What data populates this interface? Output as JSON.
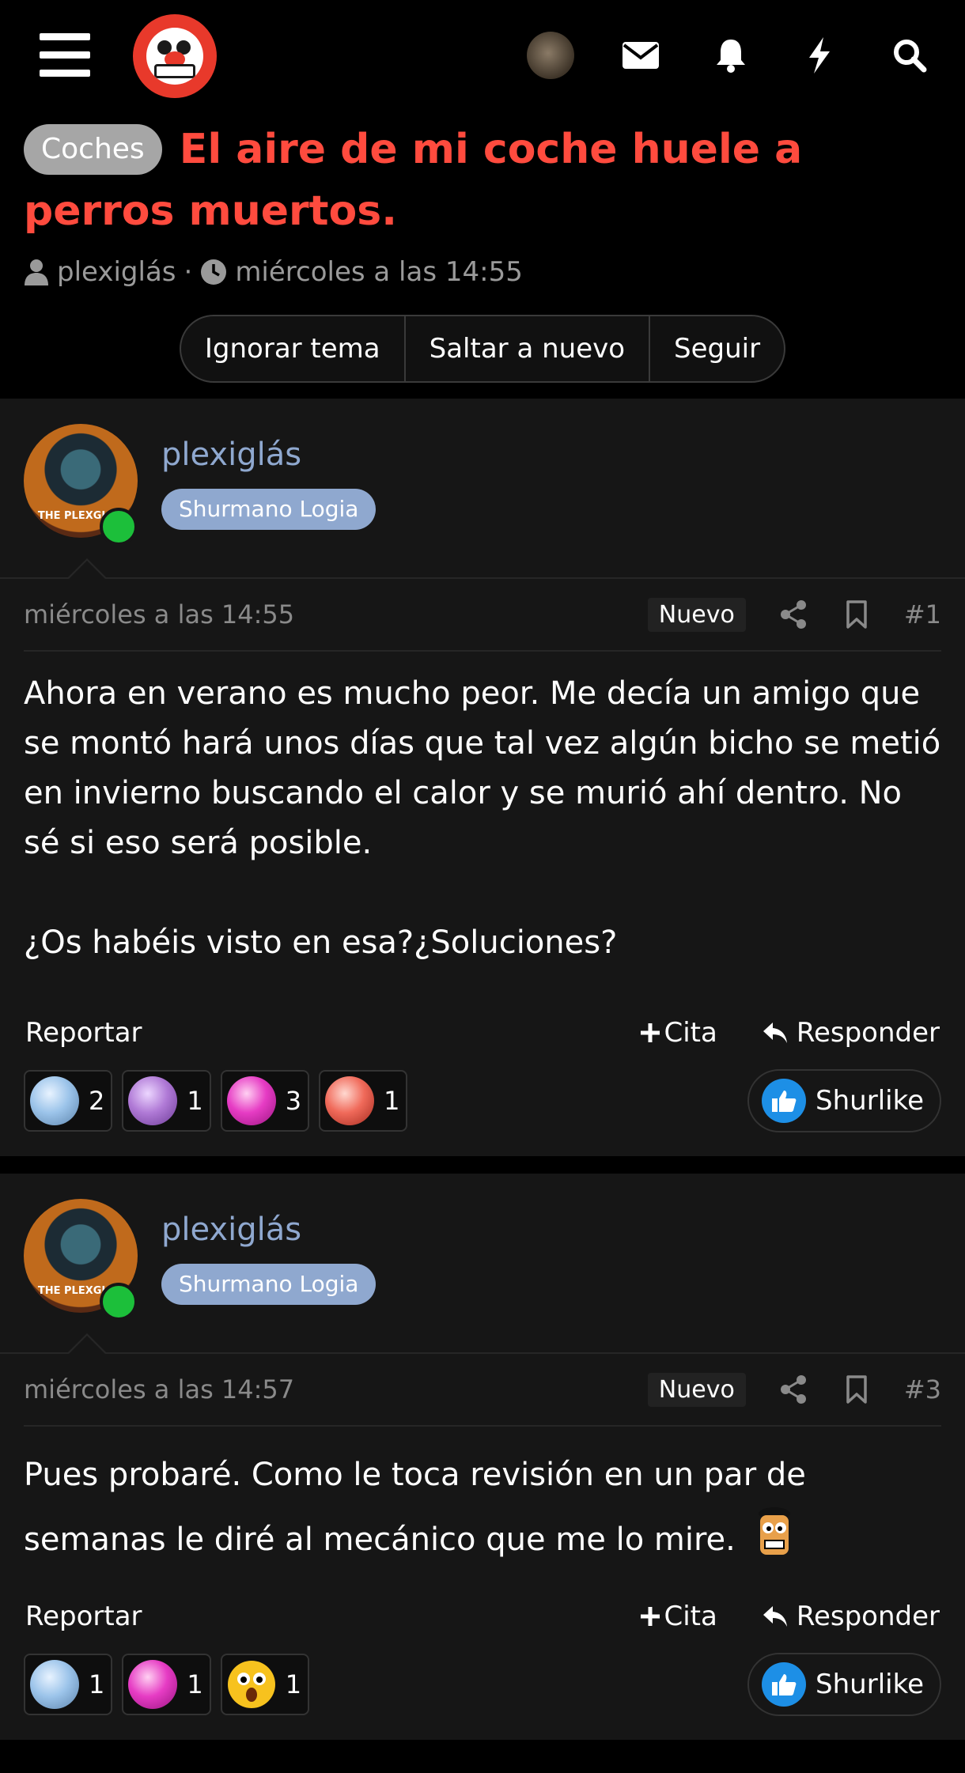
{
  "header": {
    "menu_icon": "hamburger-icon",
    "logo": "shurbird-logo",
    "icons": [
      "mail-icon",
      "bell-icon",
      "bolt-icon",
      "search-icon"
    ]
  },
  "thread": {
    "prefix": "Coches",
    "title": "El aire de mi coche huele a perros muertos.",
    "author": "plexiglás",
    "separator": "·",
    "date": "miércoles a las 14:55",
    "actions": [
      "Ignorar tema",
      "Saltar a nuevo",
      "Seguir"
    ]
  },
  "posts": [
    {
      "username": "plexiglás",
      "badge": "Shurmano Logia",
      "avatar_caption": "THE PLEXGLAS",
      "date": "miércoles a las 14:55",
      "new_label": "Nuevo",
      "number": "#1",
      "paragraphs": [
        "Ahora en verano es mucho peor. Me decía un amigo que se montó hará unos días que tal vez algún bicho se metió en invierno buscando el calor y se murió ahí dentro. No sé si eso será posible.",
        "¿Os habéis visto en esa?¿Soluciones?"
      ],
      "report": "Reportar",
      "quote": "Cita",
      "reply": "Responder",
      "reactions": [
        {
          "icon": "blue-gem-icon",
          "color": "#9cc4ea",
          "count": "2"
        },
        {
          "icon": "purple-gem-icon",
          "color": "#b07ad6",
          "count": "1"
        },
        {
          "icon": "pink-gem-icon",
          "color": "#e63cc4",
          "count": "3"
        },
        {
          "icon": "red-gem-icon",
          "color": "#f06a5a",
          "count": "1"
        }
      ],
      "like_label": "Shurlike"
    },
    {
      "username": "plexiglás",
      "badge": "Shurmano Logia",
      "avatar_caption": "THE PLEXGLAS",
      "date": "miércoles a las 14:57",
      "new_label": "Nuevo",
      "number": "#3",
      "paragraphs": [
        "Pues probaré. Como le toca revisión en un par de semanas le diré al mecánico que me lo mire."
      ],
      "report": "Reportar",
      "quote": "Cita",
      "reply": "Responder",
      "reactions": [
        {
          "icon": "blue-gem-icon",
          "color": "#9cc4ea",
          "count": "1"
        },
        {
          "icon": "pink-gem-icon",
          "color": "#e63cc4",
          "count": "1"
        },
        {
          "icon": "shocked-face-icon",
          "color": "#f7c21e",
          "count": "1"
        }
      ],
      "like_label": "Shurlike"
    }
  ]
}
